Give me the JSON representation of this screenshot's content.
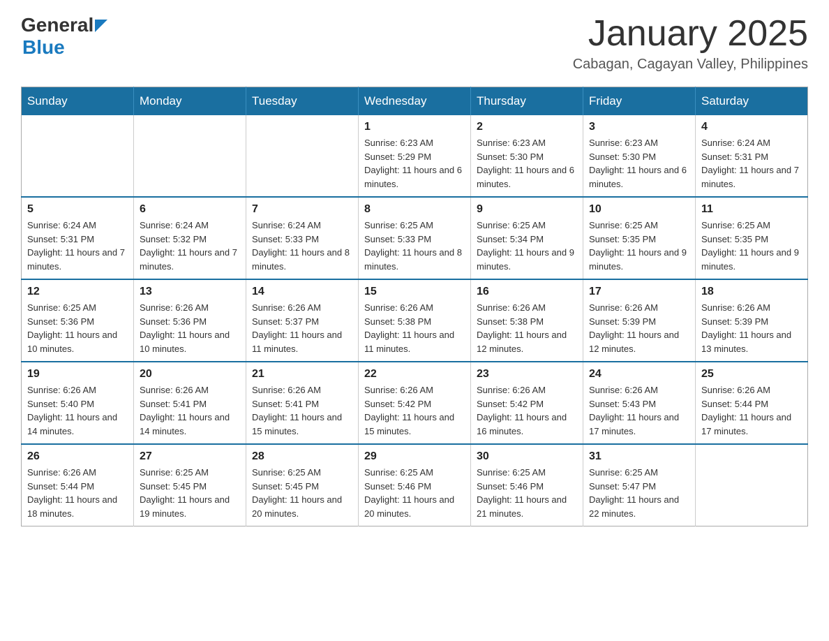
{
  "logo": {
    "general": "General",
    "blue": "Blue",
    "tagline": ""
  },
  "title": {
    "month_year": "January 2025",
    "location": "Cabagan, Cagayan Valley, Philippines"
  },
  "header_days": [
    "Sunday",
    "Monday",
    "Tuesday",
    "Wednesday",
    "Thursday",
    "Friday",
    "Saturday"
  ],
  "weeks": [
    [
      {
        "day": "",
        "info": ""
      },
      {
        "day": "",
        "info": ""
      },
      {
        "day": "",
        "info": ""
      },
      {
        "day": "1",
        "info": "Sunrise: 6:23 AM\nSunset: 5:29 PM\nDaylight: 11 hours and 6 minutes."
      },
      {
        "day": "2",
        "info": "Sunrise: 6:23 AM\nSunset: 5:30 PM\nDaylight: 11 hours and 6 minutes."
      },
      {
        "day": "3",
        "info": "Sunrise: 6:23 AM\nSunset: 5:30 PM\nDaylight: 11 hours and 6 minutes."
      },
      {
        "day": "4",
        "info": "Sunrise: 6:24 AM\nSunset: 5:31 PM\nDaylight: 11 hours and 7 minutes."
      }
    ],
    [
      {
        "day": "5",
        "info": "Sunrise: 6:24 AM\nSunset: 5:31 PM\nDaylight: 11 hours and 7 minutes."
      },
      {
        "day": "6",
        "info": "Sunrise: 6:24 AM\nSunset: 5:32 PM\nDaylight: 11 hours and 7 minutes."
      },
      {
        "day": "7",
        "info": "Sunrise: 6:24 AM\nSunset: 5:33 PM\nDaylight: 11 hours and 8 minutes."
      },
      {
        "day": "8",
        "info": "Sunrise: 6:25 AM\nSunset: 5:33 PM\nDaylight: 11 hours and 8 minutes."
      },
      {
        "day": "9",
        "info": "Sunrise: 6:25 AM\nSunset: 5:34 PM\nDaylight: 11 hours and 9 minutes."
      },
      {
        "day": "10",
        "info": "Sunrise: 6:25 AM\nSunset: 5:35 PM\nDaylight: 11 hours and 9 minutes."
      },
      {
        "day": "11",
        "info": "Sunrise: 6:25 AM\nSunset: 5:35 PM\nDaylight: 11 hours and 9 minutes."
      }
    ],
    [
      {
        "day": "12",
        "info": "Sunrise: 6:25 AM\nSunset: 5:36 PM\nDaylight: 11 hours and 10 minutes."
      },
      {
        "day": "13",
        "info": "Sunrise: 6:26 AM\nSunset: 5:36 PM\nDaylight: 11 hours and 10 minutes."
      },
      {
        "day": "14",
        "info": "Sunrise: 6:26 AM\nSunset: 5:37 PM\nDaylight: 11 hours and 11 minutes."
      },
      {
        "day": "15",
        "info": "Sunrise: 6:26 AM\nSunset: 5:38 PM\nDaylight: 11 hours and 11 minutes."
      },
      {
        "day": "16",
        "info": "Sunrise: 6:26 AM\nSunset: 5:38 PM\nDaylight: 11 hours and 12 minutes."
      },
      {
        "day": "17",
        "info": "Sunrise: 6:26 AM\nSunset: 5:39 PM\nDaylight: 11 hours and 12 minutes."
      },
      {
        "day": "18",
        "info": "Sunrise: 6:26 AM\nSunset: 5:39 PM\nDaylight: 11 hours and 13 minutes."
      }
    ],
    [
      {
        "day": "19",
        "info": "Sunrise: 6:26 AM\nSunset: 5:40 PM\nDaylight: 11 hours and 14 minutes."
      },
      {
        "day": "20",
        "info": "Sunrise: 6:26 AM\nSunset: 5:41 PM\nDaylight: 11 hours and 14 minutes."
      },
      {
        "day": "21",
        "info": "Sunrise: 6:26 AM\nSunset: 5:41 PM\nDaylight: 11 hours and 15 minutes."
      },
      {
        "day": "22",
        "info": "Sunrise: 6:26 AM\nSunset: 5:42 PM\nDaylight: 11 hours and 15 minutes."
      },
      {
        "day": "23",
        "info": "Sunrise: 6:26 AM\nSunset: 5:42 PM\nDaylight: 11 hours and 16 minutes."
      },
      {
        "day": "24",
        "info": "Sunrise: 6:26 AM\nSunset: 5:43 PM\nDaylight: 11 hours and 17 minutes."
      },
      {
        "day": "25",
        "info": "Sunrise: 6:26 AM\nSunset: 5:44 PM\nDaylight: 11 hours and 17 minutes."
      }
    ],
    [
      {
        "day": "26",
        "info": "Sunrise: 6:26 AM\nSunset: 5:44 PM\nDaylight: 11 hours and 18 minutes."
      },
      {
        "day": "27",
        "info": "Sunrise: 6:25 AM\nSunset: 5:45 PM\nDaylight: 11 hours and 19 minutes."
      },
      {
        "day": "28",
        "info": "Sunrise: 6:25 AM\nSunset: 5:45 PM\nDaylight: 11 hours and 20 minutes."
      },
      {
        "day": "29",
        "info": "Sunrise: 6:25 AM\nSunset: 5:46 PM\nDaylight: 11 hours and 20 minutes."
      },
      {
        "day": "30",
        "info": "Sunrise: 6:25 AM\nSunset: 5:46 PM\nDaylight: 11 hours and 21 minutes."
      },
      {
        "day": "31",
        "info": "Sunrise: 6:25 AM\nSunset: 5:47 PM\nDaylight: 11 hours and 22 minutes."
      },
      {
        "day": "",
        "info": ""
      }
    ]
  ],
  "colors": {
    "header_bg": "#1a6fa0",
    "header_text": "#ffffff",
    "border": "#aaaaaa",
    "row_border": "#1a6fa0"
  }
}
